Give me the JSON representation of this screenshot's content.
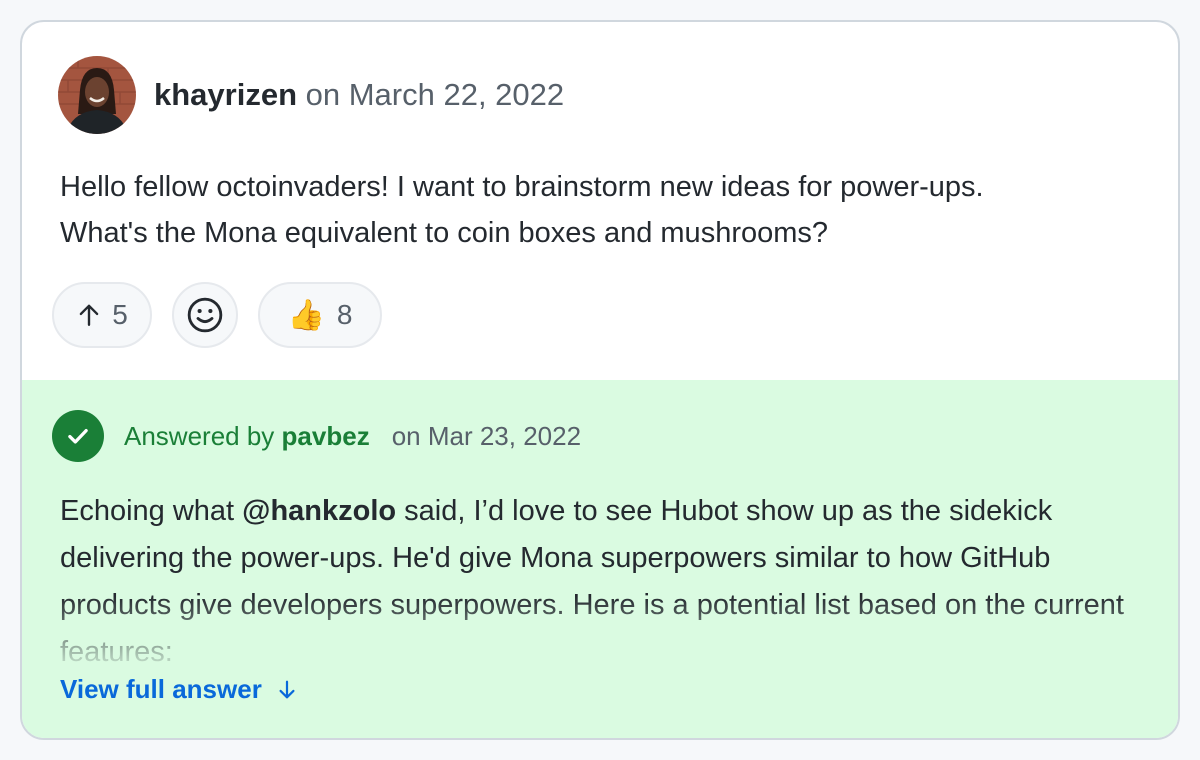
{
  "post": {
    "author": "khayrizen",
    "date_text": "on March 22, 2022",
    "body_line1": "Hello fellow octoinvaders! I want to brainstorm new ideas for power-ups.",
    "body_line2": "What's the Mona equivalent to coin boxes and mushrooms?",
    "reactions": {
      "upvote_count": "5",
      "thumbs_emoji": "👍",
      "thumbs_count": "8"
    }
  },
  "answer": {
    "answered_by_label": "Answered by",
    "answerer": "pavbez",
    "date_text": "on Mar 23, 2022",
    "body_prefix": "Echoing what ",
    "mention": "@hankzolo",
    "body_rest": " said, I’d love to see Hubot show up as the sidekick delivering the power-ups. He'd give Mona superpowers similar to how GitHub products give developers superpowers. Here is a potential list based on the current features:",
    "view_full_label": "View full answer"
  },
  "colors": {
    "answer_background": "#dafbe1",
    "success_green": "#1a7f37",
    "link_blue": "#0969da"
  },
  "icons": {
    "upvote": "arrow-up-icon",
    "add_reaction": "smiley-icon",
    "accepted": "check-circle-icon",
    "expand": "arrow-down-icon"
  }
}
